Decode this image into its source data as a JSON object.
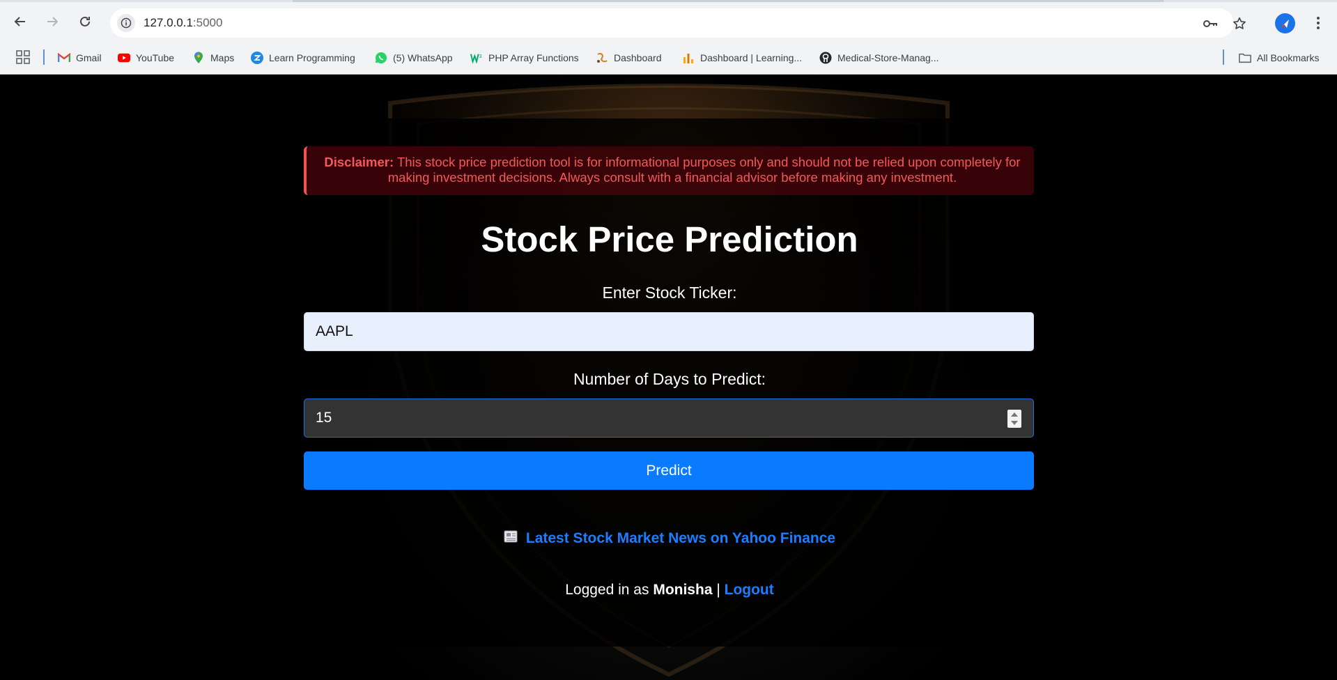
{
  "browser": {
    "url_host": "127.0.0.1",
    "url_port": ":5000",
    "bookmarks": [
      {
        "label": "Gmail",
        "icon": "gmail-icon"
      },
      {
        "label": "YouTube",
        "icon": "youtube-icon"
      },
      {
        "label": "Maps",
        "icon": "maps-icon"
      },
      {
        "label": "Learn Programming",
        "icon": "learn-programming-icon"
      },
      {
        "label": "(5) WhatsApp",
        "icon": "whatsapp-icon"
      },
      {
        "label": "PHP Array Functions",
        "icon": "w3schools-icon"
      },
      {
        "label": "Dashboard",
        "icon": "dashboard-icon"
      },
      {
        "label": "Dashboard | Learning...",
        "icon": "analytics-icon"
      },
      {
        "label": "Medical-Store-Manag...",
        "icon": "github-icon"
      }
    ],
    "all_bookmarks": "All Bookmarks"
  },
  "page": {
    "disclaimer": {
      "label": "Disclaimer:",
      "text": " This stock price prediction tool is for informational purposes only and should not be relied upon completely for making investment decisions. Always consult with a financial advisor before making any investment."
    },
    "title": "Stock Price Prediction",
    "ticker": {
      "label": "Enter Stock Ticker:",
      "value": "AAPL"
    },
    "days": {
      "label": "Number of Days to Predict:",
      "value": "15"
    },
    "predict_button": "Predict",
    "news": {
      "icon": "newspaper-icon",
      "link_text": "Latest Stock Market News on Yahoo Finance"
    },
    "login": {
      "prefix": "Logged in as ",
      "username": "Monisha",
      "separator": " | ",
      "logout": "Logout"
    }
  },
  "colors": {
    "accent": "#0a7bff",
    "disclaimer_text": "#f45858",
    "disclaimer_border": "#ef5350"
  }
}
